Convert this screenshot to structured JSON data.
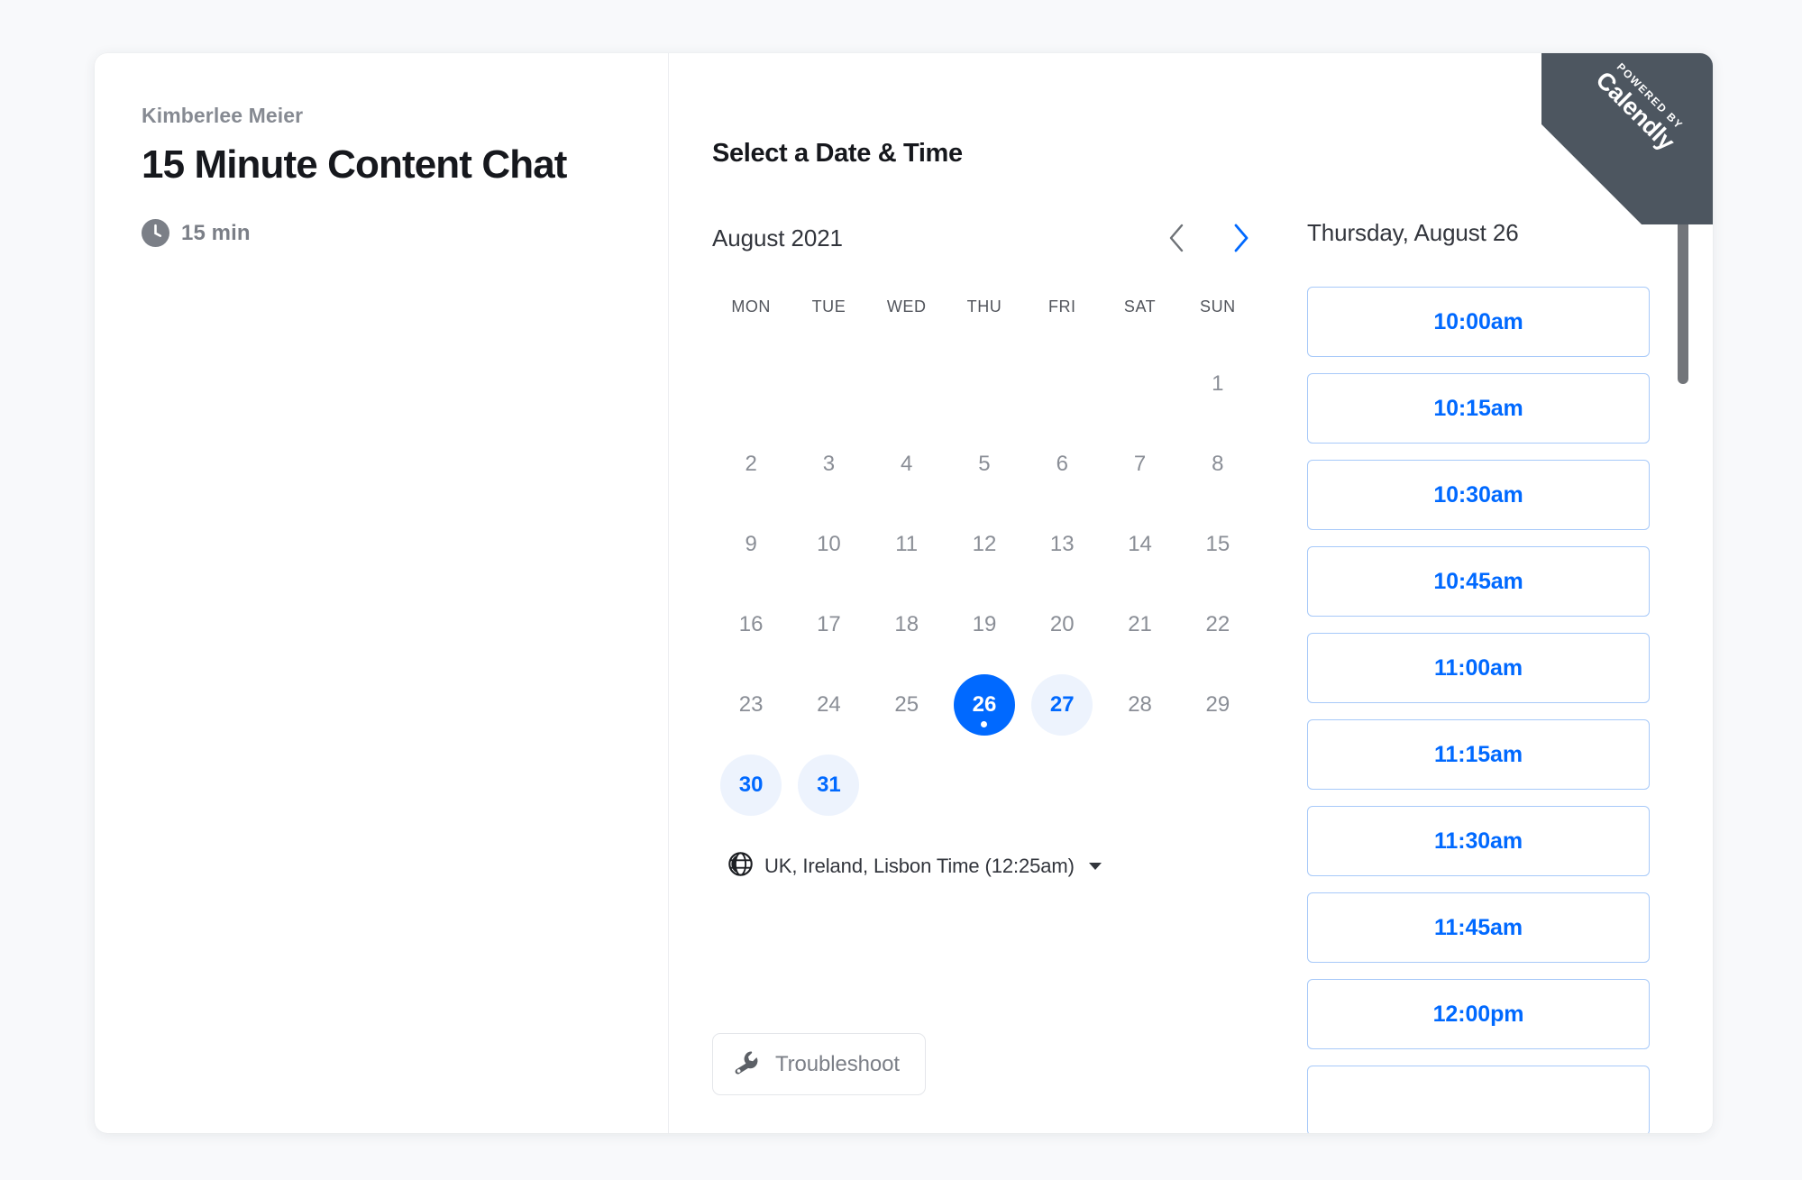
{
  "event": {
    "host_name": "Kimberlee Meier",
    "title": "15 Minute Content Chat",
    "duration_label": "15 min",
    "duration_icon": "clock-icon"
  },
  "scheduler": {
    "section_title": "Select a Date & Time"
  },
  "calendar": {
    "month_label": "August 2021",
    "prev_label": "‹",
    "next_label": "›",
    "prev_enabled": false,
    "next_enabled": true,
    "weekdays": [
      "MON",
      "TUE",
      "WED",
      "THU",
      "FRI",
      "SAT",
      "SUN"
    ],
    "leading_blanks": 6,
    "days": [
      {
        "n": "1",
        "state": "disabled"
      },
      {
        "n": "2",
        "state": "disabled"
      },
      {
        "n": "3",
        "state": "disabled"
      },
      {
        "n": "4",
        "state": "disabled"
      },
      {
        "n": "5",
        "state": "disabled"
      },
      {
        "n": "6",
        "state": "disabled"
      },
      {
        "n": "7",
        "state": "disabled"
      },
      {
        "n": "8",
        "state": "disabled"
      },
      {
        "n": "9",
        "state": "disabled"
      },
      {
        "n": "10",
        "state": "disabled"
      },
      {
        "n": "11",
        "state": "disabled"
      },
      {
        "n": "12",
        "state": "disabled"
      },
      {
        "n": "13",
        "state": "disabled"
      },
      {
        "n": "14",
        "state": "disabled"
      },
      {
        "n": "15",
        "state": "disabled"
      },
      {
        "n": "16",
        "state": "disabled"
      },
      {
        "n": "17",
        "state": "disabled"
      },
      {
        "n": "18",
        "state": "disabled"
      },
      {
        "n": "19",
        "state": "disabled"
      },
      {
        "n": "20",
        "state": "disabled"
      },
      {
        "n": "21",
        "state": "disabled"
      },
      {
        "n": "22",
        "state": "disabled"
      },
      {
        "n": "23",
        "state": "disabled"
      },
      {
        "n": "24",
        "state": "disabled"
      },
      {
        "n": "25",
        "state": "disabled"
      },
      {
        "n": "26",
        "state": "selected"
      },
      {
        "n": "27",
        "state": "available"
      },
      {
        "n": "28",
        "state": "disabled"
      },
      {
        "n": "29",
        "state": "disabled"
      },
      {
        "n": "30",
        "state": "available"
      },
      {
        "n": "31",
        "state": "available"
      }
    ]
  },
  "timezone": {
    "icon": "globe-icon",
    "label": "UK, Ireland, Lisbon Time (12:25am)"
  },
  "troubleshoot": {
    "icon": "wrench-icon",
    "label": "Troubleshoot"
  },
  "times": {
    "selected_date_label": "Thursday, August 26",
    "slots": [
      "10:00am",
      "10:15am",
      "10:30am",
      "10:45am",
      "11:00am",
      "11:15am",
      "11:30am",
      "11:45am",
      "12:00pm",
      ""
    ]
  },
  "branding": {
    "powered_by": "POWERED BY",
    "brand": "Calendly"
  },
  "colors": {
    "accent": "#0069ff",
    "accent_soft": "#edf3fd",
    "accent_border": "#a7c9f9",
    "page_bg": "#f8f9fb",
    "ribbon": "#4d5660",
    "muted_text": "#8a8e96"
  }
}
